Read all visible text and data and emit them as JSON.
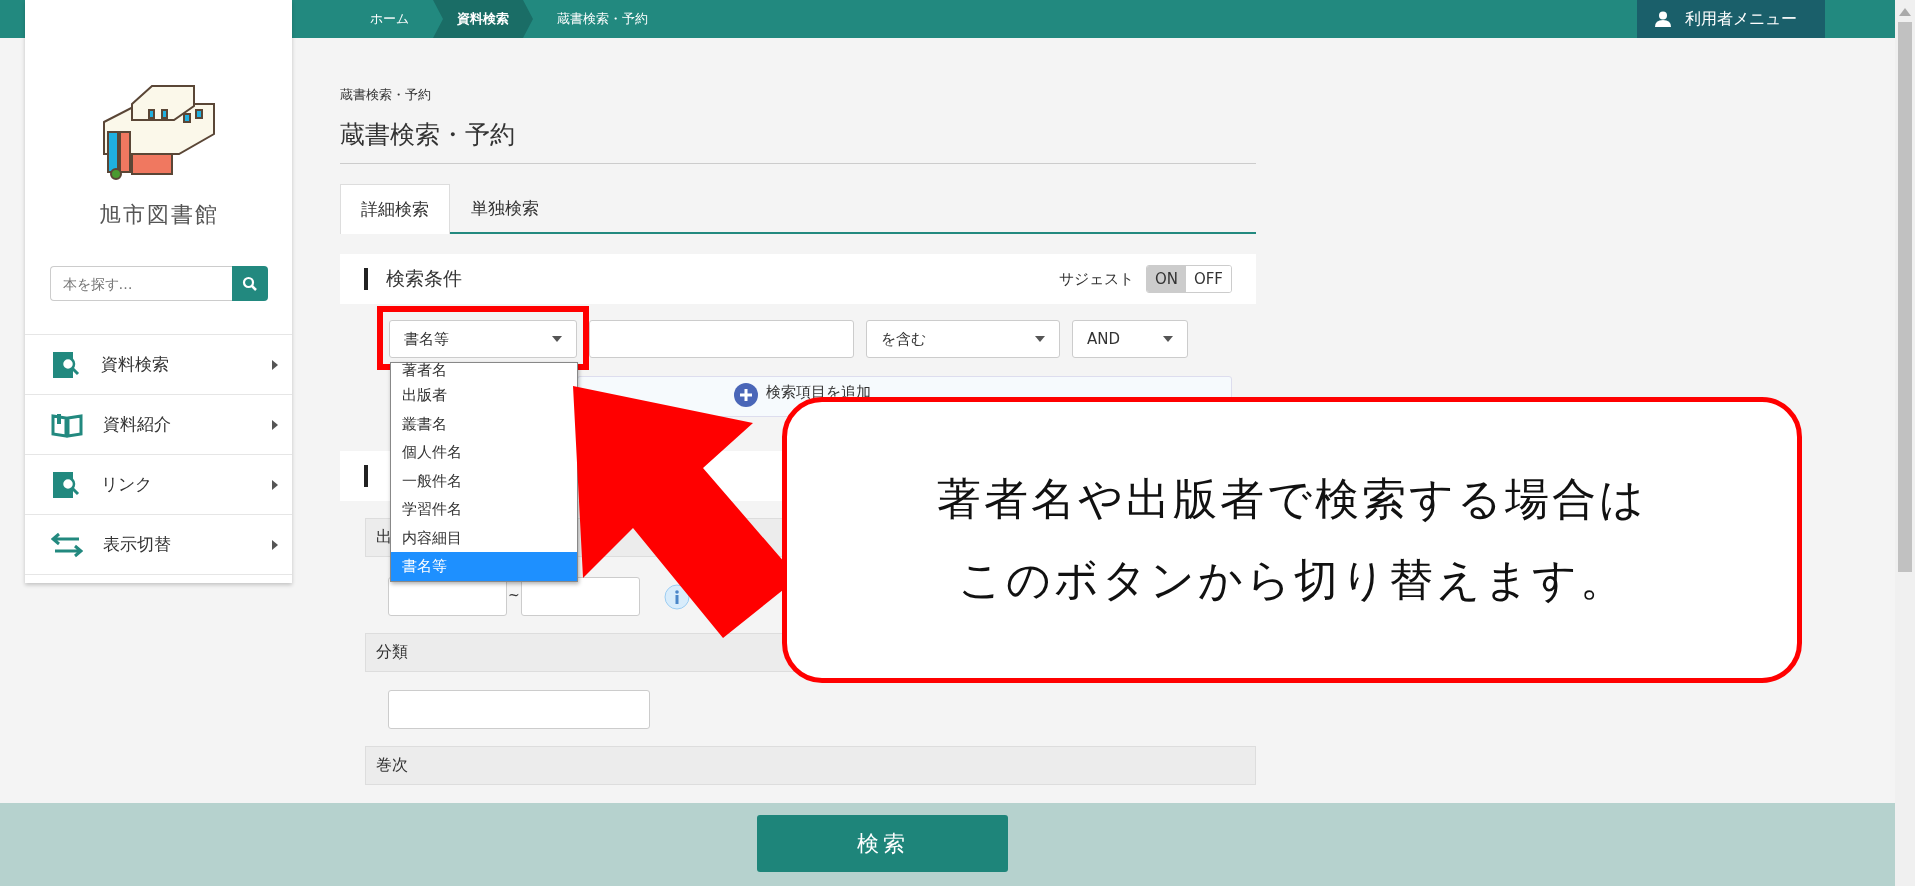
{
  "top_bar": {
    "breadcrumbs": [
      {
        "label": "ホーム",
        "selected": false
      },
      {
        "label": "資料検索",
        "selected": true
      },
      {
        "label": "蔵書検索・予約",
        "selected": false
      }
    ],
    "user_menu": "利用者メニュー"
  },
  "sidebar": {
    "library_name": "旭市図書館",
    "search": {
      "placeholder": "本を探す…"
    },
    "items": [
      {
        "label": "資料検索",
        "kind": "search-book"
      },
      {
        "label": "資料紹介",
        "kind": "book"
      },
      {
        "label": "リンク",
        "kind": "search-book"
      },
      {
        "label": "表示切替",
        "kind": "switch"
      }
    ]
  },
  "page": {
    "breadcrumb": "蔵書検索・予約",
    "title": "蔵書検索・予約",
    "tabs": [
      {
        "label": "詳細検索",
        "selected": true
      },
      {
        "label": "単独検索",
        "selected": false
      }
    ],
    "conditions": {
      "title": "検索条件",
      "suggest_label": "サジェスト",
      "suggest_options": [
        {
          "label": "ON",
          "selected": true
        },
        {
          "label": "OFF",
          "selected": false
        }
      ],
      "field_select": "書名等",
      "match_select": "を含む",
      "logic_select": "AND",
      "add_row": "検索項目を追加",
      "dropdown_options": [
        {
          "label": "著者名",
          "selected": false
        },
        {
          "label": "出版者",
          "selected": false
        },
        {
          "label": "叢書名",
          "selected": false
        },
        {
          "label": "個人件名",
          "selected": false
        },
        {
          "label": "一般件名",
          "selected": false
        },
        {
          "label": "学習件名",
          "selected": false
        },
        {
          "label": "内容細目",
          "selected": false
        },
        {
          "label": "書名等",
          "selected": true
        }
      ]
    },
    "year_label": "出",
    "year_separator": "~",
    "fields": [
      {
        "label": "分類"
      },
      {
        "label": "巻次"
      }
    ]
  },
  "search_button": "検索",
  "callout": {
    "lines": [
      "著者名や出版者で検索する場合は",
      "このボタンから切り替えます。"
    ]
  }
}
